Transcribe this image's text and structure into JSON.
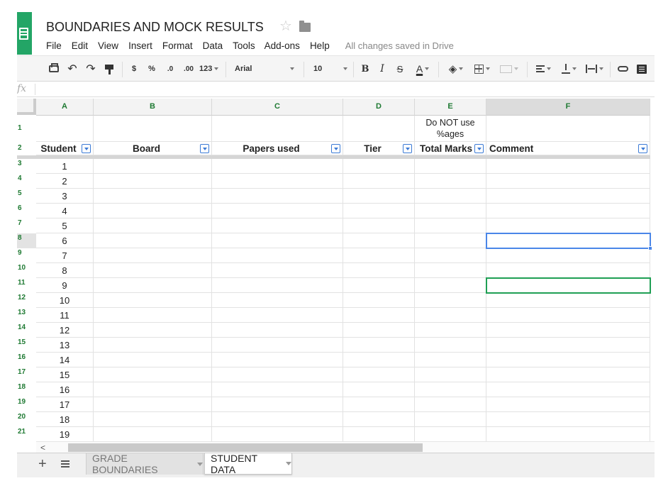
{
  "document": {
    "title": "BOUNDARIES AND MOCK RESULTS",
    "save_status": "All changes saved in Drive"
  },
  "menu": [
    "File",
    "Edit",
    "View",
    "Insert",
    "Format",
    "Data",
    "Tools",
    "Add-ons",
    "Help"
  ],
  "toolbar": {
    "currency": "$",
    "percent": "%",
    "decrease_decimals": ".0",
    "increase_decimals": ".00",
    "more_formats": "123",
    "font": "Arial",
    "font_size": "10",
    "bold": "B",
    "italic": "I",
    "strikethrough": "S",
    "text_color": "A"
  },
  "formula_bar": {
    "fx_label": "fx",
    "value": ""
  },
  "columns": [
    "A",
    "B",
    "C",
    "D",
    "E",
    "F"
  ],
  "selected_column": "F",
  "row_numbers": [
    "1",
    "2",
    "3",
    "4",
    "5",
    "6",
    "7",
    "8",
    "9",
    "10",
    "11",
    "12",
    "13",
    "14",
    "15",
    "16",
    "17",
    "18",
    "19",
    "20",
    "21"
  ],
  "selected_row": "8",
  "note_cell": {
    "column": "E",
    "row": "1",
    "text": "Do NOT use %ages"
  },
  "table_headers": [
    "Student",
    "Board",
    "Papers used",
    "Tier",
    "Total Marks",
    "Comment"
  ],
  "student_numbers": [
    "1",
    "2",
    "3",
    "4",
    "5",
    "6",
    "7",
    "8",
    "9",
    "10",
    "11",
    "12",
    "13",
    "14",
    "15",
    "16",
    "17",
    "18",
    "19"
  ],
  "sheets": [
    {
      "name": "GRADE BOUNDARIES",
      "active": false
    },
    {
      "name": "STUDENT DATA",
      "active": true
    }
  ],
  "colors": {
    "brand_green": "#23a566",
    "header_text_green": "#1f7a33",
    "selection_blue": "#4a86e8",
    "selection_green": "#1f9f54",
    "filter_blue": "#3c7bd6"
  },
  "icons": {
    "toolbar": [
      "print-icon",
      "undo-icon",
      "redo-icon",
      "paint-format-icon",
      "borders-icon",
      "merge-cells-icon",
      "align-icon",
      "vertical-align-icon",
      "text-wrap-icon",
      "link-icon",
      "comment-icon",
      "fill-color-icon"
    ],
    "header": [
      "star-icon",
      "folder-icon",
      "sheets-logo-icon"
    ]
  }
}
